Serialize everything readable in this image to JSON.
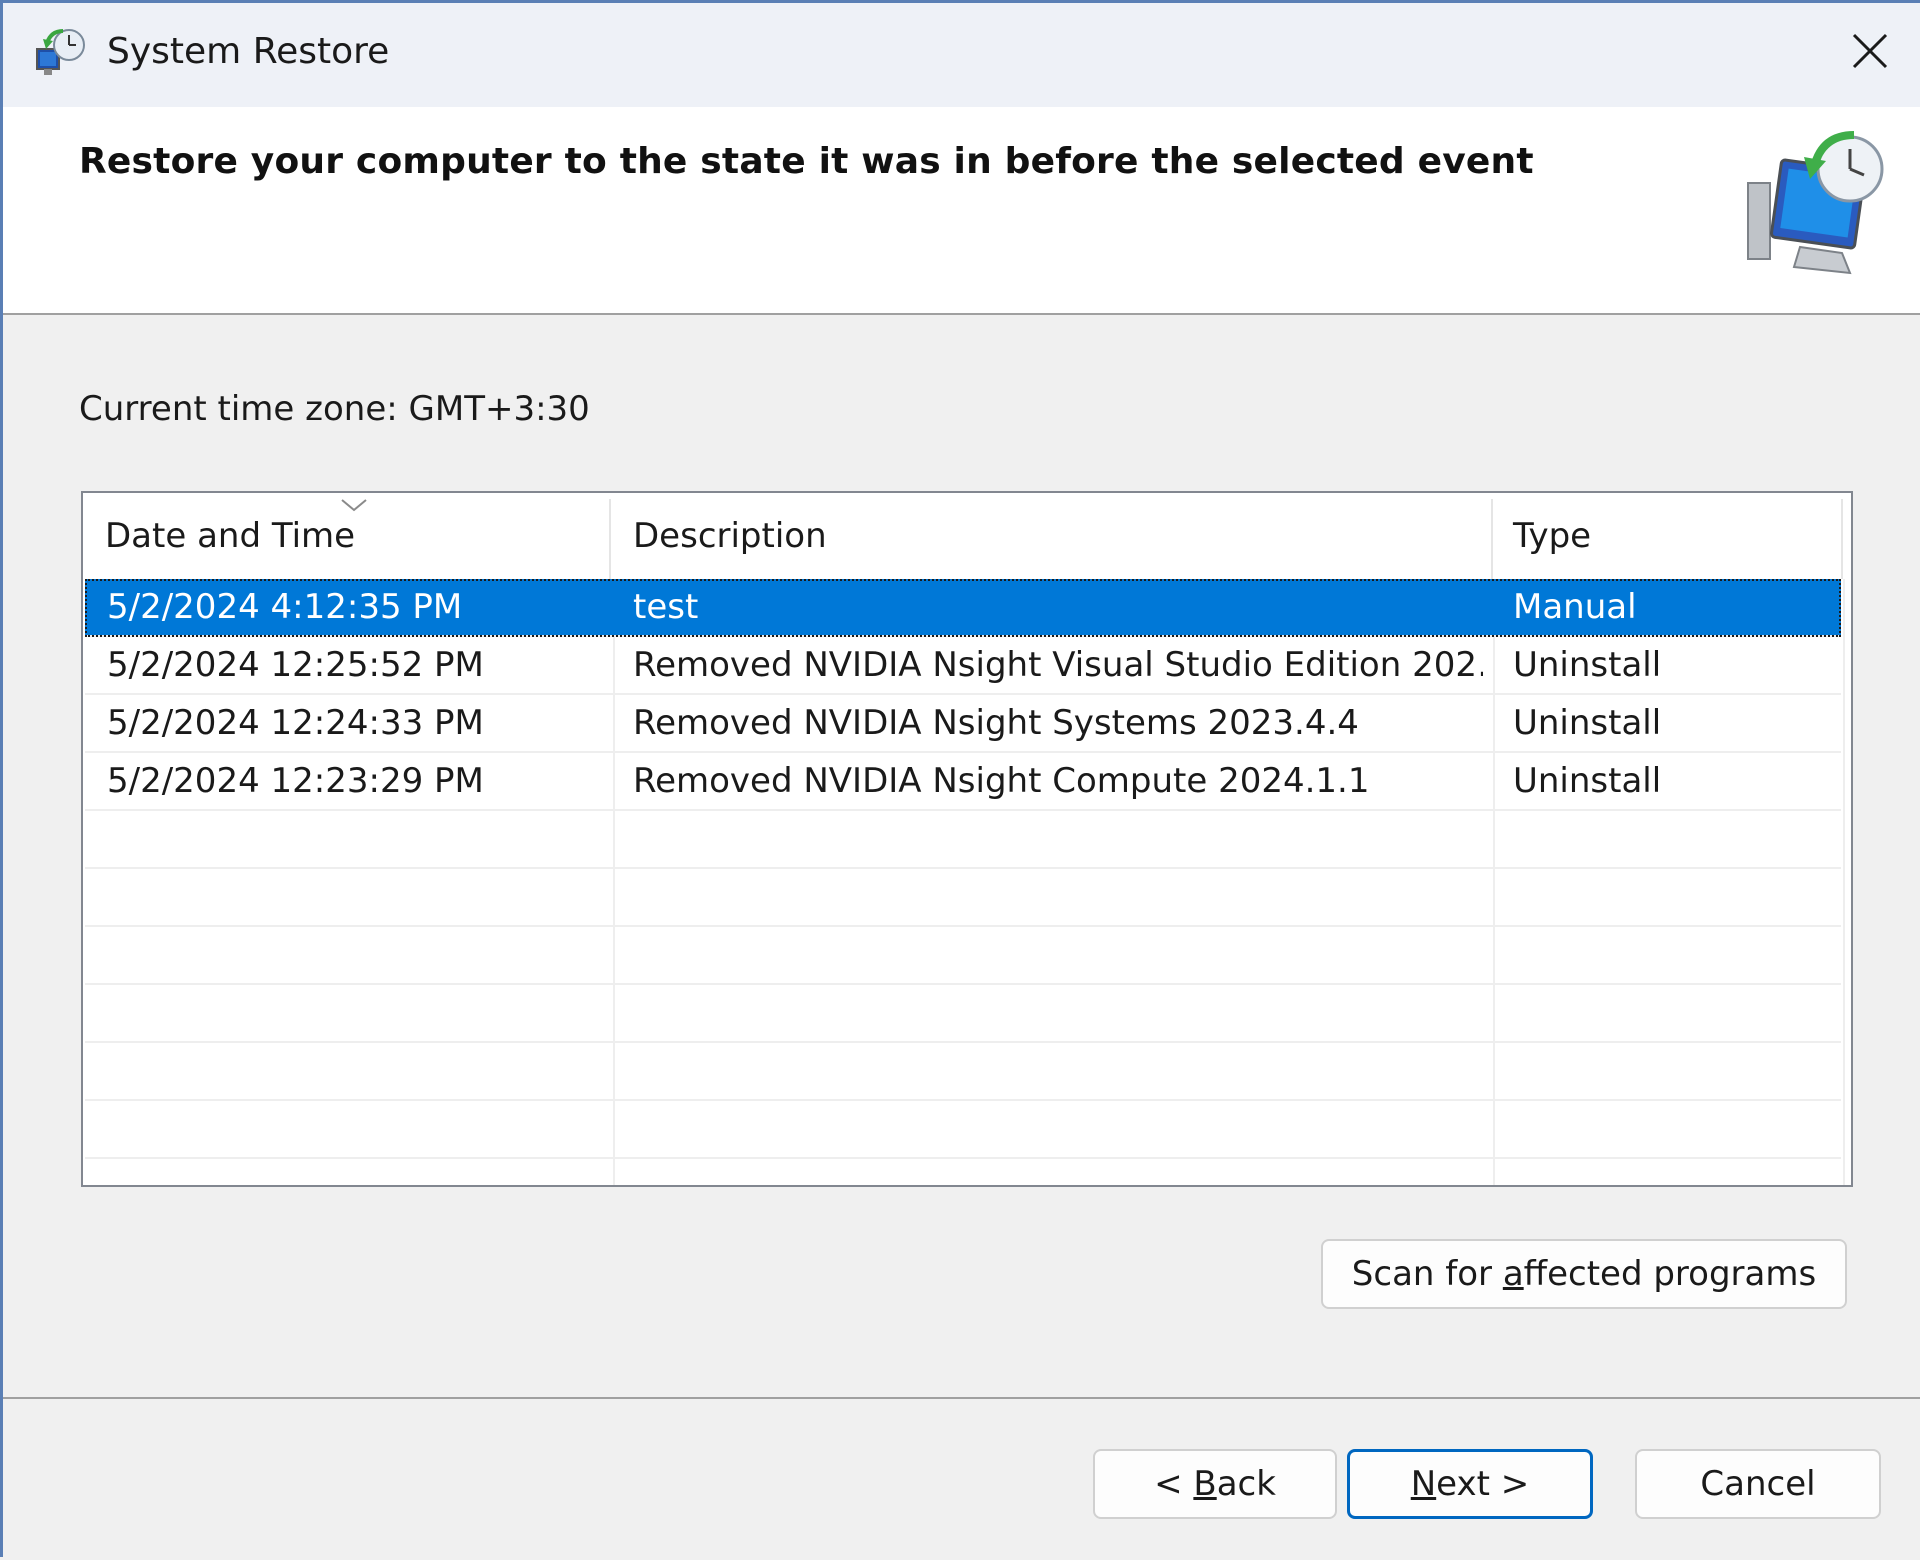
{
  "window": {
    "title": "System Restore",
    "close_icon": "close-icon",
    "app_icon": "system-restore-icon"
  },
  "header": {
    "title": "Restore your computer to the state it was in before the selected event",
    "graphic": "system-restore-graphic"
  },
  "timezone": {
    "label": "Current time zone: GMT+3:30"
  },
  "restore_points": {
    "columns": [
      "Date and Time",
      "Description",
      "Type"
    ],
    "sorted_column": "Date and Time",
    "selected_index": 0,
    "rows": [
      {
        "datetime": "5/2/2024 4:12:35 PM",
        "description": "test",
        "type": "Manual"
      },
      {
        "datetime": "5/2/2024 12:25:52 PM",
        "description": "Removed NVIDIA Nsight Visual Studio Edition 202…",
        "type": "Uninstall"
      },
      {
        "datetime": "5/2/2024 12:24:33 PM",
        "description": "Removed NVIDIA Nsight Systems 2023.4.4",
        "type": "Uninstall"
      },
      {
        "datetime": "5/2/2024 12:23:29 PM",
        "description": "Removed NVIDIA Nsight Compute 2024.1.1",
        "type": "Uninstall"
      }
    ]
  },
  "buttons": {
    "scan_pre": "Scan for ",
    "scan_u": "a",
    "scan_post": "ffected programs",
    "back_pre": "< ",
    "back_u": "B",
    "back_post": "ack",
    "next_u": "N",
    "next_post": "ext >",
    "cancel": "Cancel"
  },
  "colors": {
    "selection": "#0078d7",
    "default_button_border": "#0067c0",
    "window_border": "#5a7fb5"
  }
}
